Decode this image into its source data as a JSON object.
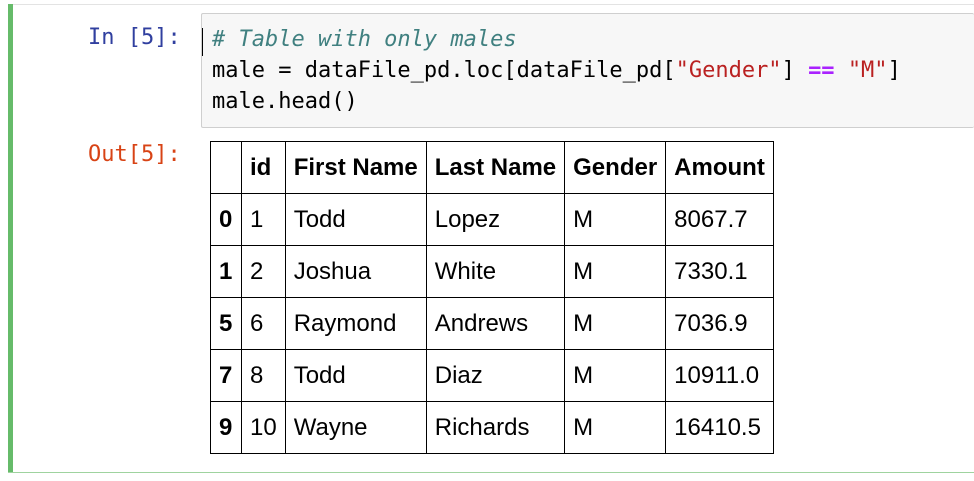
{
  "input": {
    "prompt": "In [5]:",
    "code_lines": [
      [
        {
          "t": "comment",
          "v": "# Table with only males"
        }
      ],
      [
        {
          "t": "plain",
          "v": "male = dataFile_pd.loc[dataFile_pd["
        },
        {
          "t": "str",
          "v": "\"Gender\""
        },
        {
          "t": "plain",
          "v": "] "
        },
        {
          "t": "op",
          "v": "=="
        },
        {
          "t": "plain",
          "v": " "
        },
        {
          "t": "str",
          "v": "\"M\""
        },
        {
          "t": "plain",
          "v": "]"
        }
      ],
      [
        {
          "t": "plain",
          "v": "male.head()"
        }
      ]
    ]
  },
  "output": {
    "prompt": "Out[5]:",
    "table": {
      "index_header": "",
      "columns": [
        "id",
        "First Name",
        "Last Name",
        "Gender",
        "Amount"
      ],
      "rows": [
        {
          "index": "0",
          "cells": [
            "1",
            "Todd",
            "Lopez",
            "M",
            "8067.7"
          ]
        },
        {
          "index": "1",
          "cells": [
            "2",
            "Joshua",
            "White",
            "M",
            "7330.1"
          ]
        },
        {
          "index": "5",
          "cells": [
            "6",
            "Raymond",
            "Andrews",
            "M",
            "7036.9"
          ]
        },
        {
          "index": "7",
          "cells": [
            "8",
            "Todd",
            "Diaz",
            "M",
            "10911.0"
          ]
        },
        {
          "index": "9",
          "cells": [
            "10",
            "Wayne",
            "Richards",
            "M",
            "16410.5"
          ]
        }
      ]
    }
  },
  "colors": {
    "selected_bar": "#66bb6a",
    "in_prompt": "#303f9f",
    "out_prompt": "#d84315",
    "comment": "#408080",
    "string": "#ba2121",
    "operator": "#aa22ff"
  }
}
